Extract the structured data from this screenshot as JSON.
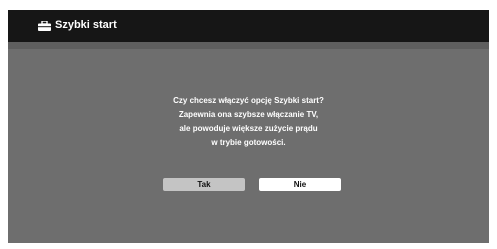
{
  "title_bar": {
    "title": "Szybki start",
    "icon": "toolbox-icon"
  },
  "dialog": {
    "lines": [
      "Czy chcesz włączyć opcję Szybki start?",
      "Zapewnia ona szybsze włączanie TV,",
      "ale powoduje większe zużycie prądu",
      "w trybie gotowości."
    ],
    "buttons": {
      "yes": "Tak",
      "no": "Nie"
    }
  },
  "colors": {
    "title_bar_bg": "#161616",
    "screen_bg": "#6e6e6e",
    "button_selected": "#ffffff",
    "button_default": "#c4c4c4"
  }
}
